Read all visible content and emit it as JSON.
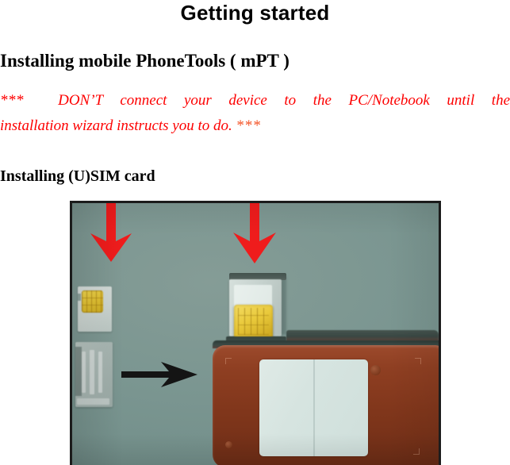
{
  "document": {
    "title": "Getting started",
    "sections": [
      {
        "heading": "Installing mobile PhoneTools ( mPT )",
        "warning": {
          "leading_asterisks": "***",
          "text": "DON’T connect your device to the PC/Notebook until the installation wizard instructs you to do.",
          "line1": "DON’T connect your device to the PC/Notebook until the",
          "line2": "installation wizard instructs you to do.",
          "trailing_asterisks": "***",
          "color": "#fd0000",
          "trailing_color": "#f4562a"
        }
      },
      {
        "heading": "Installing (U)SIM card"
      }
    ]
  },
  "figure": {
    "caption": "",
    "border_color": "#1c1c1c",
    "background_color": "#7b9691",
    "annotations": {
      "red_arrow_left": "down-arrow-icon",
      "red_arrow_right": "down-arrow-icon",
      "black_arrow": "right-arrow-icon",
      "arrow_color_red": "#ef1c1c",
      "arrow_color_black": "#141414"
    },
    "objects": {
      "loose_sim_card": "sim-card",
      "sim_tray": "sim-tray",
      "device": "mobile-phone",
      "device_body_color": "#80361b",
      "device_panel_color": "#d6e4e0",
      "sim_chip_color": "#e3c233"
    }
  }
}
